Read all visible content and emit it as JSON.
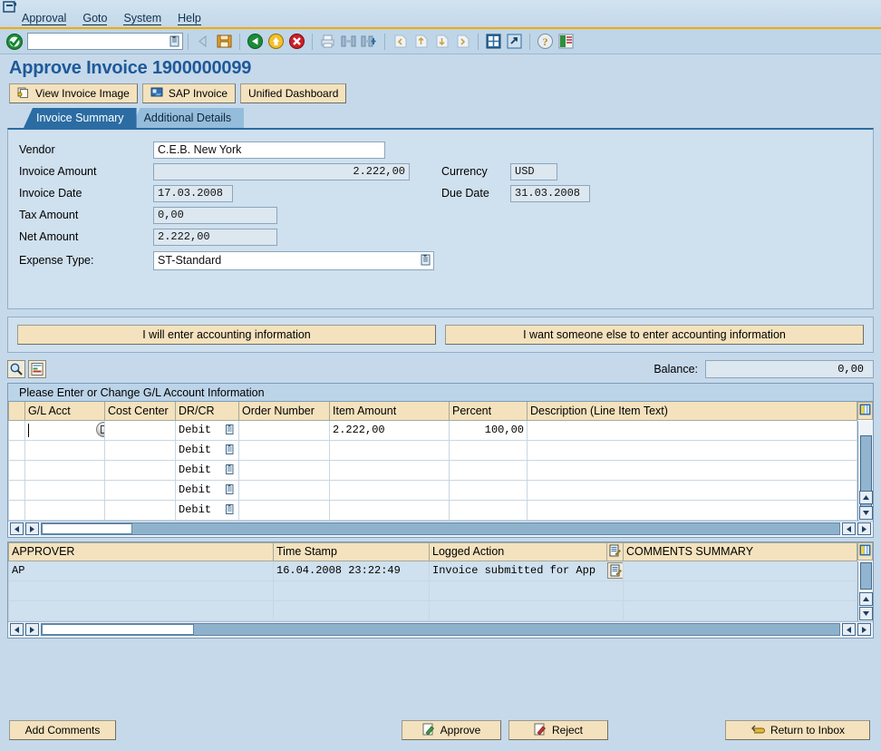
{
  "menu": {
    "window_icon": "window-exit-icon",
    "items": [
      "Approval",
      "Goto",
      "System",
      "Help"
    ]
  },
  "toolbar": {
    "ok_icon": "ok-check-icon",
    "command_value": "",
    "icons": [
      "back-arrow-icon",
      "save-icon",
      "back-green-icon",
      "exit-yellow-icon",
      "cancel-red-icon",
      "print-icon",
      "find-icon",
      "find-next-icon",
      "first-page-icon",
      "previous-page-icon",
      "next-page-icon",
      "last-page-icon",
      "new-session-icon",
      "create-shortcut-icon",
      "help-icon",
      "layout-menu-icon"
    ]
  },
  "page": {
    "title": "Approve Invoice 1900000099"
  },
  "app_buttons": [
    {
      "label": "View Invoice Image",
      "icon": "image-stack-icon"
    },
    {
      "label": "SAP Invoice",
      "icon": "sap-doc-icon"
    },
    {
      "label": "Unified Dashboard",
      "icon": ""
    }
  ],
  "tabs": [
    {
      "label": "Invoice Summary",
      "active": true
    },
    {
      "label": "Additional Details",
      "active": false
    }
  ],
  "form": {
    "vendor_label": "Vendor",
    "vendor_value": "C.E.B. New York",
    "invoice_amount_label": "Invoice Amount",
    "invoice_amount_value": "2.222,00",
    "invoice_date_label": "Invoice Date",
    "invoice_date_value": "17.03.2008",
    "tax_amount_label": "Tax Amount",
    "tax_amount_value": "0,00",
    "net_amount_label": "Net Amount",
    "net_amount_value": "2.222,00",
    "expense_type_label": "Expense Type:",
    "expense_type_value": "ST-Standard",
    "currency_label": "Currency",
    "currency_value": "USD",
    "due_date_label": "Due Date",
    "due_date_value": "31.03.2008"
  },
  "accounting_choice": {
    "self_label": "I will enter accounting information",
    "other_label": "I want someone else to enter accounting information"
  },
  "grid_toolbar": {
    "search_icon": "search-magnifier-icon",
    "detail_icon": "document-detail-icon",
    "balance_label": "Balance:",
    "balance_value": "0,00"
  },
  "gl_table": {
    "caption": "Please Enter or Change G/L Account Information",
    "column_config_icon": "column-settings-icon",
    "columns": [
      "G/L Acct",
      "Cost Center",
      "DR/CR",
      "Order Number",
      "Item Amount",
      "Percent",
      "Description (Line Item Text)"
    ],
    "rows": [
      {
        "gl_acct": "",
        "cost_center": "",
        "dr_cr": "Debit",
        "order_number": "",
        "item_amount": "2.222,00",
        "percent": "100,00",
        "description": "",
        "focused": true
      },
      {
        "gl_acct": "",
        "cost_center": "",
        "dr_cr": "Debit",
        "order_number": "",
        "item_amount": "",
        "percent": "",
        "description": "",
        "focused": false
      },
      {
        "gl_acct": "",
        "cost_center": "",
        "dr_cr": "Debit",
        "order_number": "",
        "item_amount": "",
        "percent": "",
        "description": "",
        "focused": false
      },
      {
        "gl_acct": "",
        "cost_center": "",
        "dr_cr": "Debit",
        "order_number": "",
        "item_amount": "",
        "percent": "",
        "description": "",
        "focused": false
      },
      {
        "gl_acct": "",
        "cost_center": "",
        "dr_cr": "Debit",
        "order_number": "",
        "item_amount": "",
        "percent": "",
        "description": "",
        "focused": false
      }
    ]
  },
  "approver_table": {
    "column_config_icon": "column-settings-icon",
    "log_icon": "log-document-icon",
    "columns": [
      "APPROVER",
      "Time Stamp",
      "Logged Action",
      "COMMENTS SUMMARY"
    ],
    "rows": [
      {
        "approver": "AP",
        "timestamp": "16.04.2008 23:22:49",
        "logged_action": "Invoice submitted for App",
        "comments": ""
      },
      {
        "approver": "",
        "timestamp": "",
        "logged_action": "",
        "comments": ""
      },
      {
        "approver": "",
        "timestamp": "",
        "logged_action": "",
        "comments": ""
      }
    ]
  },
  "footer": {
    "add_comments_label": "Add Comments",
    "approve_label": "Approve",
    "approve_icon": "green-pen-icon",
    "reject_label": "Reject",
    "reject_icon": "red-pen-icon",
    "return_label": "Return to Inbox",
    "return_icon": "return-inbox-icon"
  },
  "colors": {
    "background": "#c6d9ea",
    "accent_orange": "#f0ab00",
    "title_blue": "#1f5999",
    "tab_active": "#2b6ca3",
    "button_beige": "#f3e2bd",
    "header_beige": "#f3e2bd",
    "focus_yellow": "#fce9a8"
  }
}
